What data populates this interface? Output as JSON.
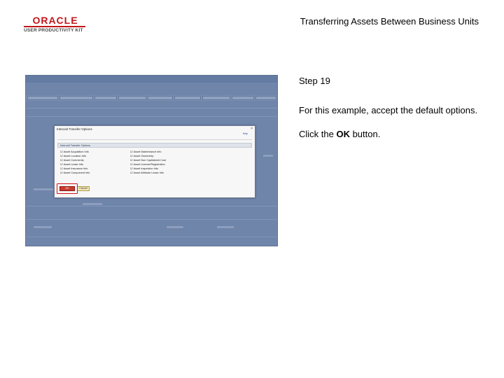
{
  "header": {
    "logo_brand": "ORACLE",
    "logo_product": "USER PRODUCTIVITY KIT",
    "title": "Transferring Assets Between Business Units"
  },
  "screenshot": {
    "modal": {
      "title": "Interunit Transfer Options",
      "close_symbol": "×",
      "help_link": "Help",
      "options_header": "Interunit Transfer Options",
      "left_options": [
        "Asset Acquisition Info",
        "Asset Location Info",
        "Asset Comments",
        "Asset Lease Info",
        "Asset Insurance Info",
        "Asset Component Info"
      ],
      "right_options": [
        "Asset Maintenance Info",
        "Asset Ownership",
        "Asset Non Capitalized Cost",
        "Asset License/Registration",
        "Asset Inspection Info",
        "Asset Attribute Lease Info"
      ],
      "ok_label": "OK",
      "cancel_label": "Cancel"
    },
    "colors": {
      "backdrop": "#7d93b7",
      "ok_button": "#c93a2e",
      "highlight": "#d4141a",
      "brand_red": "#c4161c"
    }
  },
  "instructions": {
    "step": "Step 19",
    "text": "For this example, accept the default options.",
    "click_prefix": "Click the ",
    "click_target": "OK",
    "click_suffix": " button."
  }
}
